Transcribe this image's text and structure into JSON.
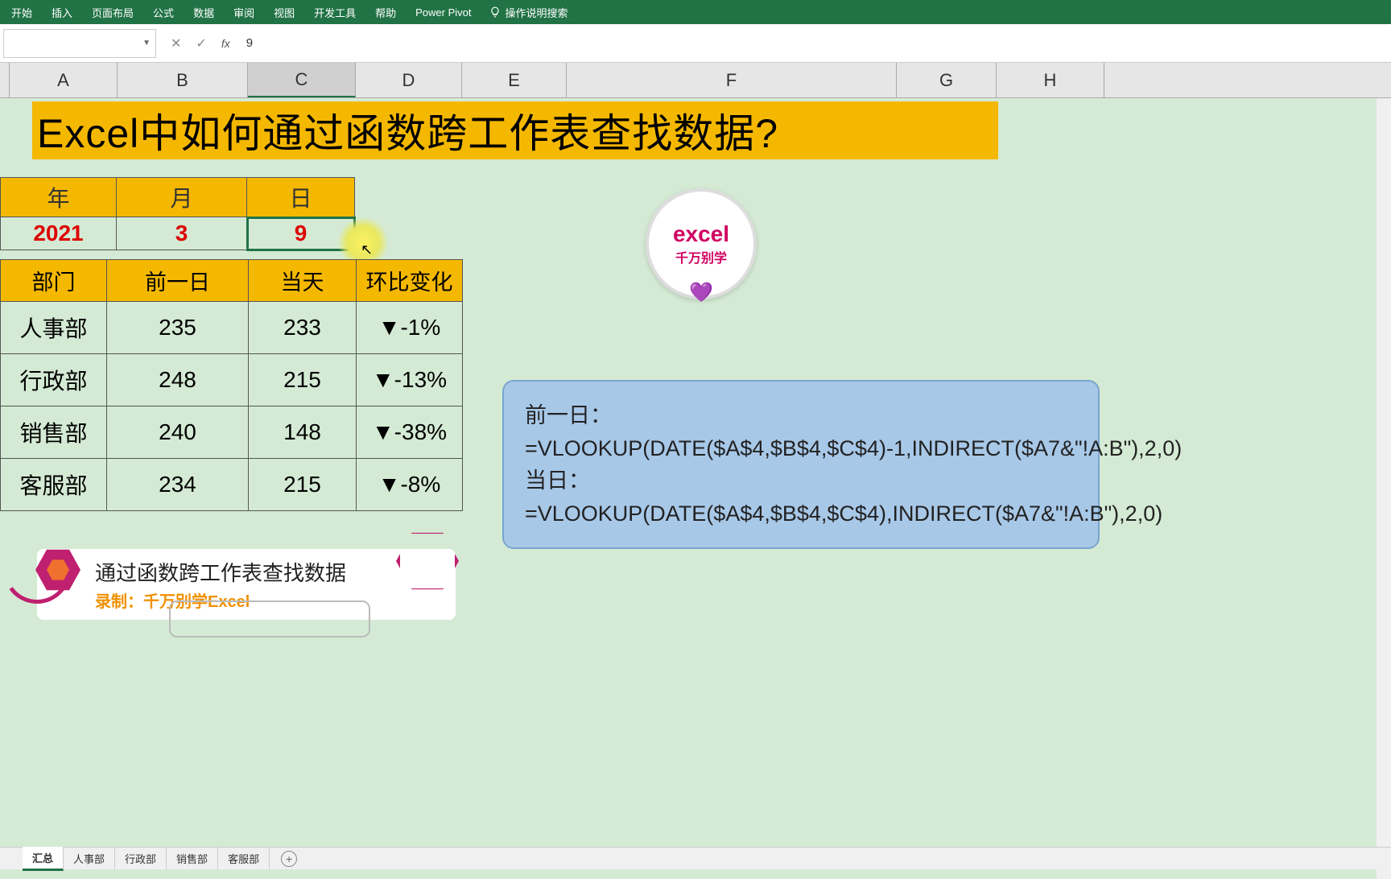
{
  "ribbon": {
    "tabs": [
      "开始",
      "插入",
      "页面布局",
      "公式",
      "数据",
      "审阅",
      "视图",
      "开发工具",
      "帮助",
      "Power Pivot"
    ],
    "search_label": "操作说明搜索"
  },
  "formula_bar": {
    "name_box": "",
    "value": "9"
  },
  "columns": [
    "A",
    "B",
    "C",
    "D",
    "E",
    "F",
    "G",
    "H"
  ],
  "title": "Excel中如何通过函数跨工作表查找数据?",
  "date_table": {
    "headers": [
      "年",
      "月",
      "日"
    ],
    "values": [
      "2021",
      "3",
      "9"
    ]
  },
  "data_table": {
    "headers": [
      "部门",
      "前一日",
      "当天",
      "环比变化"
    ],
    "rows": [
      {
        "dept": "人事部",
        "prev": "235",
        "today": "233",
        "chg": "▼-1%"
      },
      {
        "dept": "行政部",
        "prev": "248",
        "today": "215",
        "chg": "▼-13%"
      },
      {
        "dept": "销售部",
        "prev": "240",
        "today": "148",
        "chg": "▼-38%"
      },
      {
        "dept": "客服部",
        "prev": "234",
        "today": "215",
        "chg": "▼-8%"
      }
    ]
  },
  "logo": {
    "line1": "excel",
    "line2": "千万别学",
    "heart": "💜"
  },
  "formula_note": {
    "l1": "前一日：",
    "l2": "=VLOOKUP(DATE($A$4,$B$4,$C$4)-1,INDIRECT($A7&\"!A:B\"),2,0)",
    "l3": "当日：",
    "l4": "=VLOOKUP(DATE($A$4,$B$4,$C$4),INDIRECT($A7&\"!A:B\"),2,0)"
  },
  "caption": {
    "line1": "通过函数跨工作表查找数据",
    "line2": "录制：千万别学Excel"
  },
  "sheet_tabs": [
    "汇总",
    "人事部",
    "行政部",
    "销售部",
    "客服部"
  ]
}
